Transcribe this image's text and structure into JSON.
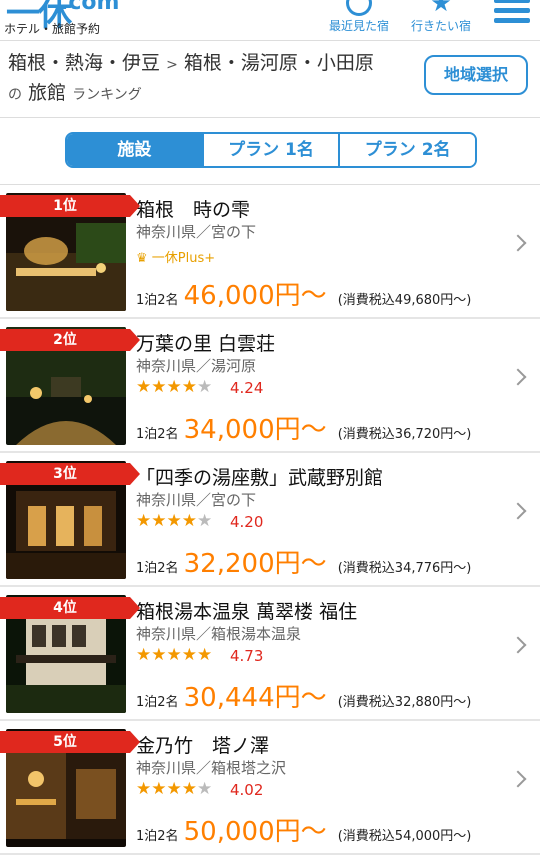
{
  "header": {
    "logo_text": "一休",
    "logo_domain": ".com",
    "logo_sub": "ホテル・旅館予約",
    "nav": [
      {
        "label": "最近見た宿",
        "icon": "clock-icon"
      },
      {
        "label": "行きたい宿",
        "icon": "star-icon"
      }
    ],
    "menu_icon": "hamburger-menu-icon"
  },
  "breadcrumb": {
    "region": "箱根・熱海・伊豆",
    "separator": ">",
    "area": "箱根・湯河原・小田原",
    "of": "の",
    "category": "旅館",
    "suffix": "ランキング"
  },
  "region_button": "地域選択",
  "tabs": [
    {
      "label": "施設",
      "active": true
    },
    {
      "label": "プラン 1名",
      "active": false
    },
    {
      "label": "プラン 2名",
      "active": false
    }
  ],
  "items": [
    {
      "rank": "1位",
      "name": "箱根　時の雫",
      "location": "神奈川県／宮の下",
      "plus": "一休Plus+",
      "stars": null,
      "score": null,
      "price_prefix": "1泊2名",
      "price": "46,000円",
      "tilde": "〜",
      "tax": "(消費税込49,680円〜)"
    },
    {
      "rank": "2位",
      "name": "万葉の里 白雲荘",
      "location": "神奈川県／湯河原",
      "plus": null,
      "stars": "★★★★",
      "stars_empty": "★",
      "score": "4.24",
      "price_prefix": "1泊2名",
      "price": "34,000円",
      "tilde": "〜",
      "tax": "(消費税込36,720円〜)"
    },
    {
      "rank": "3位",
      "name": "「四季の湯座敷」武蔵野別館",
      "location": "神奈川県／宮の下",
      "plus": null,
      "stars": "★★★★",
      "stars_empty": "★",
      "score": "4.20",
      "price_prefix": "1泊2名",
      "price": "32,200円",
      "tilde": "〜",
      "tax": "(消費税込34,776円〜)"
    },
    {
      "rank": "4位",
      "name": "箱根湯本温泉 萬翠楼 福住",
      "location": "神奈川県／箱根湯本温泉",
      "plus": null,
      "stars": "★★★★★",
      "stars_empty": "",
      "score": "4.73",
      "price_prefix": "1泊2名",
      "price": "30,444円",
      "tilde": "〜",
      "tax": "(消費税込32,880円〜)"
    },
    {
      "rank": "5位",
      "name": "金乃竹　塔ノ澤",
      "location": "神奈川県／箱根塔之沢",
      "plus": null,
      "stars": "★★★★",
      "stars_empty": "★",
      "score": "4.02",
      "price_prefix": "1泊2名",
      "price": "50,000円",
      "tilde": "〜",
      "tax": "(消費税込54,000円〜)"
    }
  ],
  "colors": {
    "accent": "#2d8fd5",
    "rank": "#e0281e",
    "price": "#ff7f00",
    "star": "#f39800"
  }
}
